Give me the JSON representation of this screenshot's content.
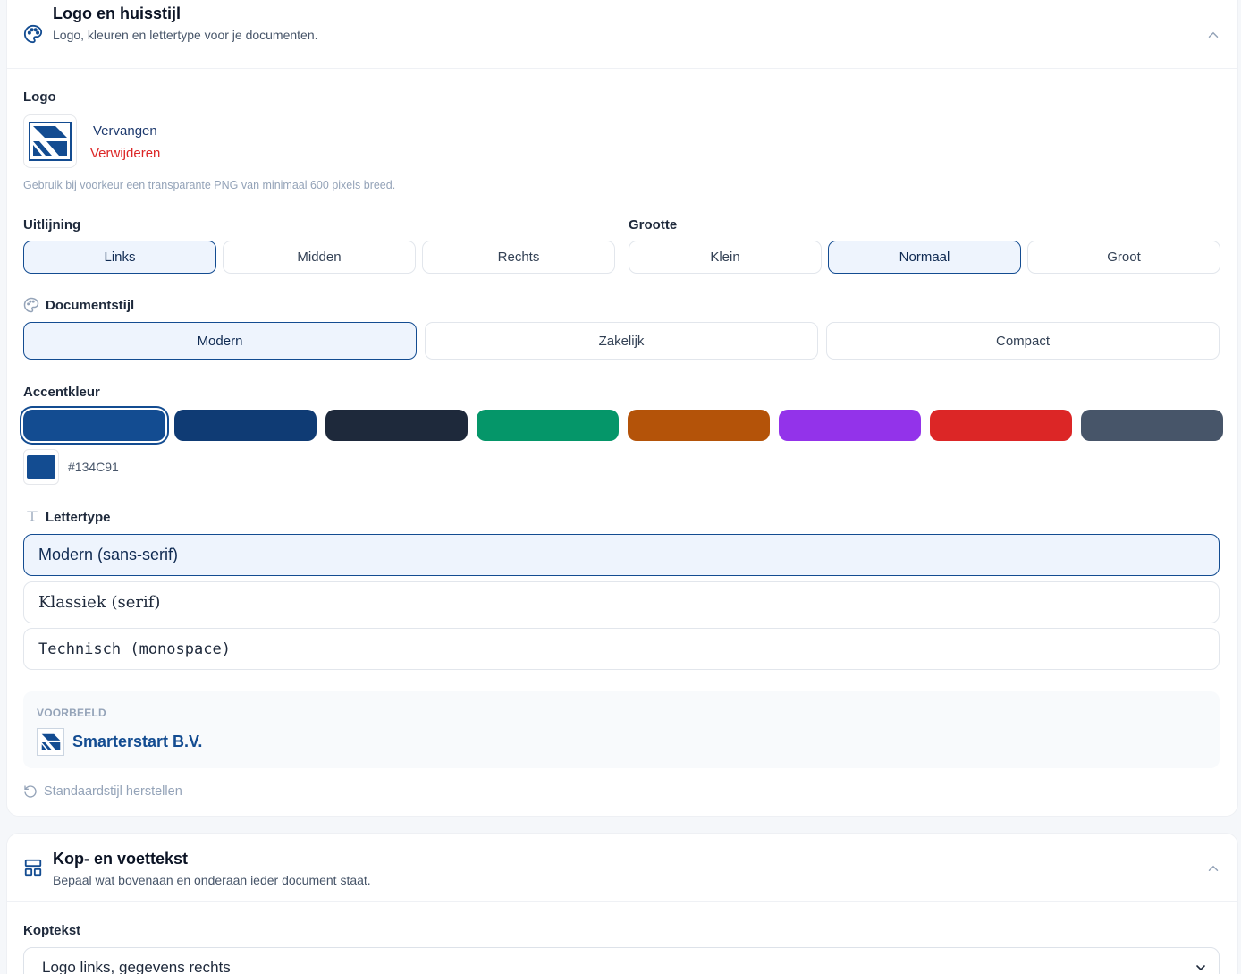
{
  "branding": {
    "title": "Logo en huisstijl",
    "subtitle": "Logo, kleuren en lettertype voor je documenten.",
    "logo_label": "Logo",
    "replace_label": "Vervangen",
    "remove_label": "Verwijderen",
    "logo_hint": "Gebruik bij voorkeur een transparante PNG van minimaal 600 pixels breed.",
    "alignment": {
      "label": "Uitlijning",
      "options": [
        "Links",
        "Midden",
        "Rechts"
      ],
      "selected": "Links"
    },
    "size": {
      "label": "Grootte",
      "options": [
        "Klein",
        "Normaal",
        "Groot"
      ],
      "selected": "Normaal"
    },
    "doc_style": {
      "label": "Documentstijl",
      "options": [
        "Modern",
        "Zakelijk",
        "Compact"
      ],
      "selected": "Modern"
    },
    "accent": {
      "label": "Accentkleur",
      "swatches": [
        "#134C91",
        "#0f3b74",
        "#1e293b",
        "#059669",
        "#b45309",
        "#9333ea",
        "#dc2626",
        "#475569"
      ],
      "selected": "#134C91",
      "hex_value": "#134C91"
    },
    "font": {
      "label": "Lettertype",
      "options": [
        "Modern (sans-serif)",
        "Klassiek (serif)",
        "Technisch (monospace)"
      ],
      "selected": "Modern (sans-serif)"
    },
    "preview": {
      "label": "VOORBEELD",
      "company": "Smarterstart B.V."
    },
    "reset_label": "Standaardstijl herstellen"
  },
  "header_footer": {
    "title": "Kop- en voettekst",
    "subtitle": "Bepaal wat bovenaan en onderaan ieder document staat.",
    "header_label": "Koptekst",
    "header_value": "Logo links, gegevens rechts"
  },
  "colors": {
    "accent": "#134C91",
    "danger": "#dc2626",
    "link": "#1e3a6e"
  },
  "icons": [
    "palette-icon",
    "chevron-up-icon",
    "logo-icon",
    "type-icon",
    "reset-icon",
    "layout-icon",
    "chevron-down-icon"
  ]
}
